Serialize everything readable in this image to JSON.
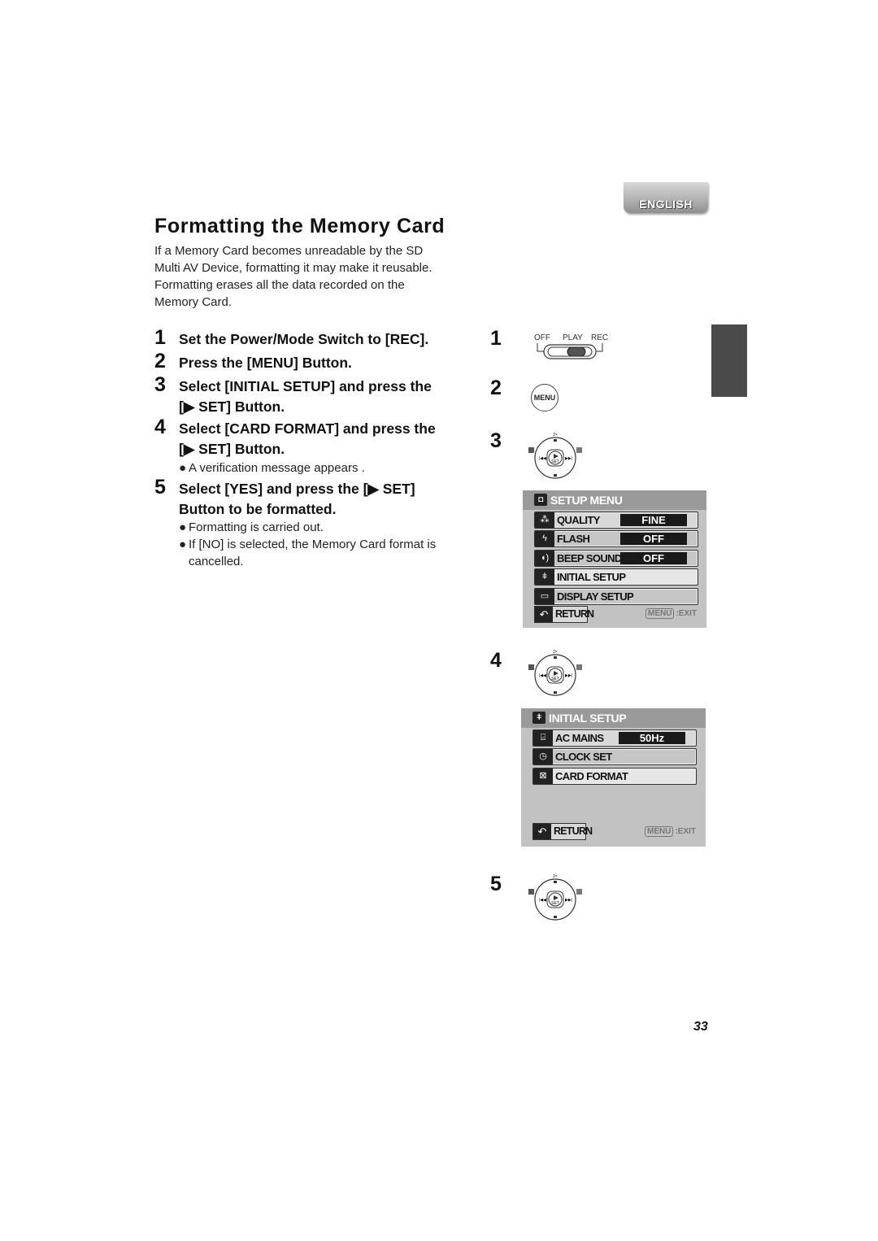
{
  "language_tab": "ENGLISH",
  "title": "Formatting the Memory Card",
  "intro": [
    "If a Memory Card becomes unreadable by the SD",
    "Multi AV Device, formatting it may make it reusable.",
    "Formatting erases all the data recorded on the",
    "Memory Card."
  ],
  "steps": [
    {
      "num": "1",
      "lines": [
        "Set the Power/Mode Switch to [REC]."
      ]
    },
    {
      "num": "2",
      "lines": [
        "Press the [MENU] Button."
      ]
    },
    {
      "num": "3",
      "lines": [
        "Select [INITIAL SETUP] and press the",
        "[▶ SET] Button."
      ]
    },
    {
      "num": "4",
      "lines": [
        "Select [CARD FORMAT] and press the",
        "[▶ SET] Button."
      ],
      "notes": [
        "A verification message appears ."
      ]
    },
    {
      "num": "5",
      "lines": [
        "Select [YES] and press the [▶ SET]",
        "Button to be formatted."
      ],
      "notes": [
        "Formatting is carried out.",
        "If [NO] is selected, the Memory Card format is",
        "cancelled."
      ]
    }
  ],
  "figures": {
    "labels": [
      "1",
      "2",
      "3",
      "4",
      "5"
    ],
    "switch": {
      "off": "OFF",
      "play": "PLAY",
      "rec": "REC"
    },
    "menu_button": "MENU",
    "dial": {
      "top": "2×",
      "set": "SET"
    },
    "setup_menu": {
      "title": "SETUP MENU",
      "rows": [
        {
          "label": "QUALITY",
          "value": "FINE"
        },
        {
          "label": "FLASH",
          "value": "OFF"
        },
        {
          "label": "BEEP SOUND",
          "value": "OFF"
        },
        {
          "label": "INITIAL SETUP",
          "value": ""
        },
        {
          "label": "DISPLAY SETUP",
          "value": ""
        }
      ],
      "return": "RETURN",
      "exit_key": "MENU",
      "exit": ":EXIT"
    },
    "initial_setup": {
      "title": "INITIAL SETUP",
      "rows": [
        {
          "label": "AC MAINS",
          "value": "50Hz"
        },
        {
          "label": "CLOCK SET",
          "value": ""
        },
        {
          "label": "CARD FORMAT",
          "value": ""
        }
      ],
      "return": "RETURN",
      "exit_key": "MENU",
      "exit": ":EXIT"
    }
  },
  "page_number": "33"
}
